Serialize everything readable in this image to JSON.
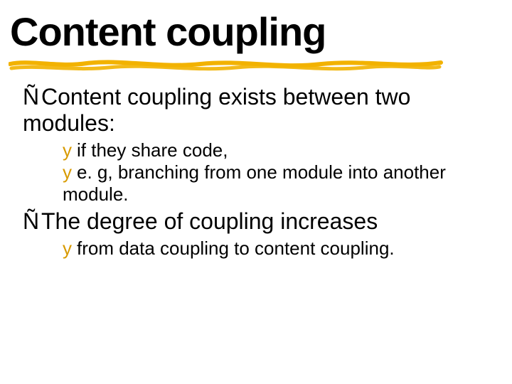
{
  "title": "Content coupling",
  "bullets": {
    "main1": {
      "marker": "Ñ",
      "text": "Content coupling exists between two modules:"
    },
    "sub1a": {
      "marker": "y",
      "text": "if  they share code,"
    },
    "sub1b": {
      "marker": "y",
      "text": "e. g, branching from one module into another module."
    },
    "main2": {
      "marker": "Ñ",
      "text": "The degree of coupling increases"
    },
    "sub2a": {
      "marker": "y",
      "text": "from data coupling to content coupling."
    }
  }
}
